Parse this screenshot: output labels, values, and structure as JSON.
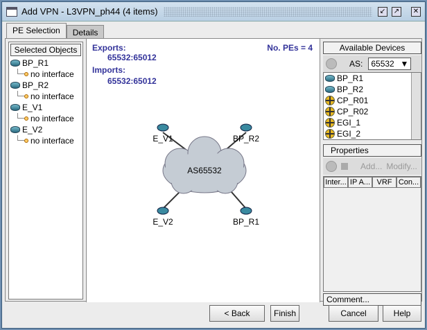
{
  "window": {
    "title": "Add VPN - L3VPN_ph44 (4 items)"
  },
  "tabs": [
    {
      "label": "PE Selection"
    },
    {
      "label": "Details"
    }
  ],
  "selected_objects": {
    "header": "Selected Objects",
    "items": [
      {
        "name": "BP_R1",
        "sub": "no interface"
      },
      {
        "name": "BP_R2",
        "sub": "no interface"
      },
      {
        "name": "E_V1",
        "sub": "no interface"
      },
      {
        "name": "E_V2",
        "sub": "no interface"
      }
    ]
  },
  "center": {
    "exports_label": "Exports:",
    "exports_value": "65532:65012",
    "imports_label": "Imports:",
    "imports_value": "65532:65012",
    "pe_count": "No. PEs = 4",
    "diagram": {
      "cloud": "AS65532",
      "nodes": [
        "E_V1",
        "BP_R2",
        "E_V2",
        "BP_R1"
      ]
    }
  },
  "available": {
    "header": "Available Devices",
    "as_label": "AS:",
    "as_value": "65532",
    "devices": [
      {
        "name": "BP_R1",
        "icon": "router"
      },
      {
        "name": "BP_R2",
        "icon": "router"
      },
      {
        "name": "CP_R01",
        "icon": "cross"
      },
      {
        "name": "CP_R02",
        "icon": "cross"
      },
      {
        "name": "EGI_1",
        "icon": "cross"
      },
      {
        "name": "EGI_2",
        "icon": "cross"
      }
    ]
  },
  "properties": {
    "header": "Properties",
    "add": "Add...",
    "modify": "Modify...",
    "columns": [
      "Inter...",
      "IP A...",
      "VRF",
      "Con..."
    ],
    "comment": "Comment..."
  },
  "buttons": {
    "back": "< Back",
    "finish": "Finish",
    "cancel": "Cancel",
    "help": "Help"
  }
}
